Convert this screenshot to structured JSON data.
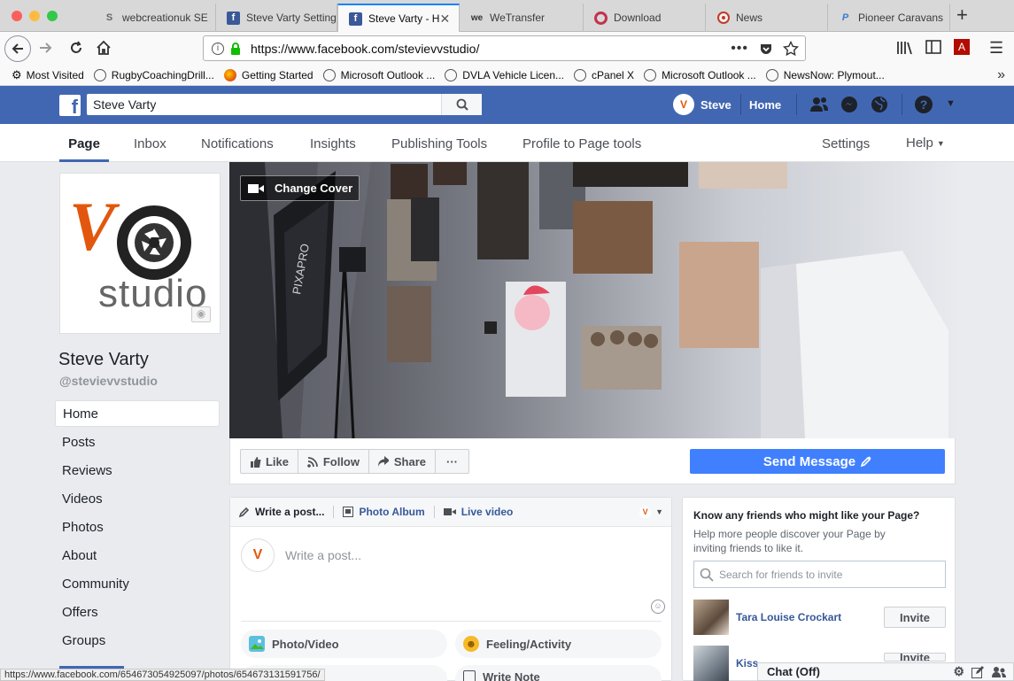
{
  "browser": {
    "tabs": [
      {
        "title": "webcreationuk SE",
        "icon": "s-icon"
      },
      {
        "title": "Steve Varty Setting",
        "icon": "facebook-icon"
      },
      {
        "title": "Steve Varty - H",
        "icon": "facebook-icon",
        "active": true
      },
      {
        "title": "WeTransfer",
        "icon": "wetransfer-icon"
      },
      {
        "title": "Download",
        "icon": "download-icon"
      },
      {
        "title": "News",
        "icon": "news-icon"
      },
      {
        "title": "Pioneer Caravans",
        "icon": "pioneer-icon"
      }
    ],
    "url": "https://www.facebook.com/stevievvstudio/",
    "bookmarks": [
      "Most Visited",
      "RugbyCoachingDrill...",
      "Getting Started",
      "Microsoft Outlook ...",
      "DVLA Vehicle Licen...",
      "cPanel X",
      "Microsoft Outlook ...",
      "NewsNow: Plymout..."
    ],
    "status_url": "https://www.facebook.com/654673054925097/photos/654673131591756/"
  },
  "fb": {
    "search_value": "Steve Varty",
    "user_name": "Steve",
    "home_label": "Home",
    "brand_color": "#4267b2"
  },
  "page_nav": [
    "Page",
    "Inbox",
    "Notifications",
    "Insights",
    "Publishing Tools",
    "Profile to Page tools"
  ],
  "page_nav_right": {
    "settings": "Settings",
    "help": "Help"
  },
  "profile": {
    "logo_letter": "V",
    "logo_word": "studio",
    "name": "Steve Varty",
    "handle": "@stevievvstudio"
  },
  "left_nav": [
    "Home",
    "Posts",
    "Reviews",
    "Videos",
    "Photos",
    "About",
    "Community",
    "Offers",
    "Groups"
  ],
  "cover": {
    "change_cover": "Change Cover",
    "softbox_text": "PIXAPRO"
  },
  "actions": {
    "like": "Like",
    "follow": "Follow",
    "share": "Share",
    "more": "···",
    "send_message": "Send Message"
  },
  "composer": {
    "tabs": [
      "Write a post...",
      "Photo Album",
      "Live video"
    ],
    "placeholder": "Write a post...",
    "buttons": [
      "Photo/Video",
      "Feeling/Activity",
      "",
      "Write Note"
    ]
  },
  "invite": {
    "title": "Know any friends who might like your Page?",
    "desc": "Help more people discover your Page by inviting friends to like it.",
    "search_placeholder": "Search for friends to invite",
    "friends": [
      {
        "name": "Tara Louise Crockart",
        "button": "Invite"
      },
      {
        "name": "Kiss",
        "button": "Invite"
      }
    ]
  },
  "chat": {
    "label": "Chat (Off)"
  }
}
